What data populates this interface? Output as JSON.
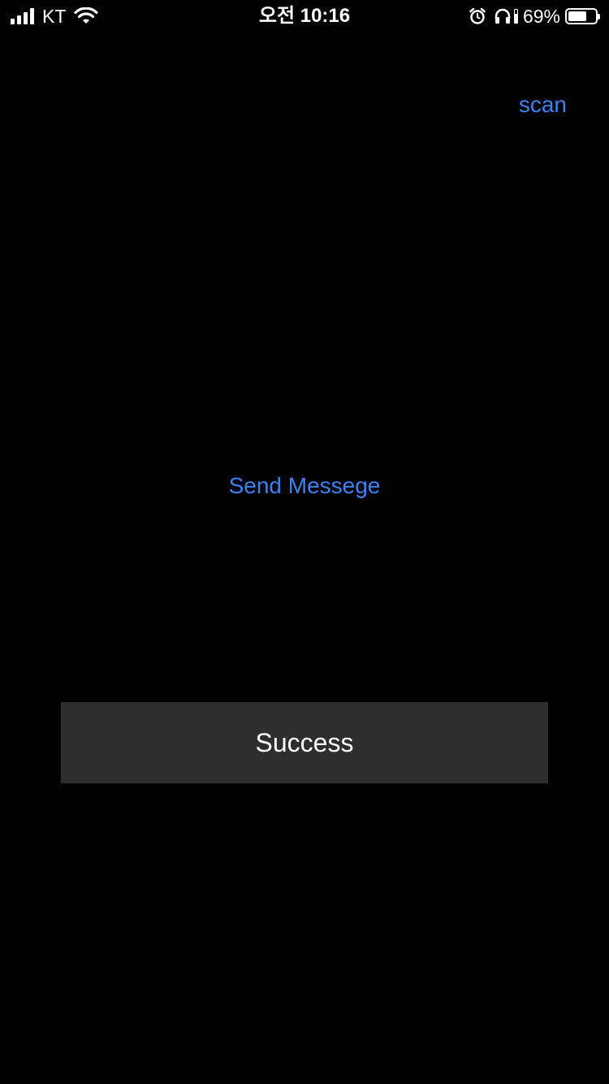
{
  "status_bar": {
    "carrier": "KT",
    "time": "오전 10:16",
    "battery_percent_label": "69%",
    "battery_level": 0.69,
    "icons": [
      "signal-icon",
      "wifi-icon",
      "alarm-icon",
      "headphones-icon",
      "battery-icon"
    ]
  },
  "toolbar": {
    "scan_label": "scan"
  },
  "main": {
    "send_message_label": "Send Messege",
    "status_label": "Success"
  },
  "colors": {
    "background": "#000000",
    "accent": "#3b82f6",
    "status_box": "#2e2e2e",
    "text": "#ffffff"
  }
}
